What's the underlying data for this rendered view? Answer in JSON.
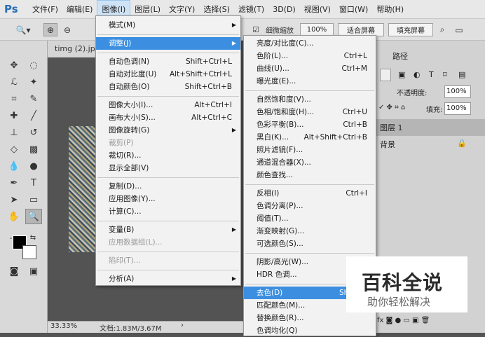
{
  "app": {
    "logo": "Ps"
  },
  "menubar": {
    "items": [
      "文件(F)",
      "编辑(E)",
      "图像(I)",
      "图层(L)",
      "文字(Y)",
      "选择(S)",
      "滤镜(T)",
      "3D(D)",
      "视图(V)",
      "窗口(W)",
      "帮助(H)"
    ],
    "active_index": 2
  },
  "options": {
    "fine_zoom_label": "细微缩放",
    "zoom_percent": "100%",
    "fit_screen": "适合屏幕",
    "fill_screen": "填充屏幕"
  },
  "document": {
    "tab_name": "timg (2).jpg",
    "zoom": "33.33%",
    "doc_size": "文档:1.83M/3.67M"
  },
  "right_panel": {
    "tab_paths": "路径",
    "opacity_label": "不透明度:",
    "opacity_value": "100%",
    "fill_label": "填充:",
    "fill_value": "100%",
    "layer1": "图层 1",
    "background": "背景"
  },
  "image_menu": {
    "items": [
      {
        "label": "模式(M)",
        "shortcut": "",
        "submenu": true
      },
      {
        "label": "调整(J)",
        "shortcut": "",
        "submenu": true,
        "highlight": true
      },
      {
        "label": "自动色调(N)",
        "shortcut": "Shift+Ctrl+L"
      },
      {
        "label": "自动对比度(U)",
        "shortcut": "Alt+Shift+Ctrl+L"
      },
      {
        "label": "自动颜色(O)",
        "shortcut": "Shift+Ctrl+B"
      },
      {
        "label": "图像大小(I)...",
        "shortcut": "Alt+Ctrl+I"
      },
      {
        "label": "画布大小(S)...",
        "shortcut": "Alt+Ctrl+C"
      },
      {
        "label": "图像旋转(G)",
        "shortcut": "",
        "submenu": true
      },
      {
        "label": "裁剪(P)",
        "shortcut": "",
        "disabled": true
      },
      {
        "label": "裁切(R)...",
        "shortcut": ""
      },
      {
        "label": "显示全部(V)",
        "shortcut": ""
      },
      {
        "label": "复制(D)...",
        "shortcut": ""
      },
      {
        "label": "应用图像(Y)...",
        "shortcut": ""
      },
      {
        "label": "计算(C)...",
        "shortcut": ""
      },
      {
        "label": "变量(B)",
        "shortcut": "",
        "submenu": true
      },
      {
        "label": "应用数据组(L)...",
        "shortcut": "",
        "disabled": true
      },
      {
        "label": "陷印(T)...",
        "shortcut": "",
        "disabled": true
      },
      {
        "label": "分析(A)",
        "shortcut": "",
        "submenu": true
      }
    ]
  },
  "adjust_menu": {
    "items": [
      {
        "label": "亮度/对比度(C)...",
        "shortcut": ""
      },
      {
        "label": "色阶(L)...",
        "shortcut": "Ctrl+L"
      },
      {
        "label": "曲线(U)...",
        "shortcut": "Ctrl+M"
      },
      {
        "label": "曝光度(E)...",
        "shortcut": ""
      },
      {
        "label": "自然饱和度(V)...",
        "shortcut": ""
      },
      {
        "label": "色相/饱和度(H)...",
        "shortcut": "Ctrl+U"
      },
      {
        "label": "色彩平衡(B)...",
        "shortcut": "Ctrl+B"
      },
      {
        "label": "黑白(K)...",
        "shortcut": "Alt+Shift+Ctrl+B"
      },
      {
        "label": "照片滤镜(F)...",
        "shortcut": ""
      },
      {
        "label": "通道混合器(X)...",
        "shortcut": ""
      },
      {
        "label": "颜色查找...",
        "shortcut": ""
      },
      {
        "label": "反相(I)",
        "shortcut": "Ctrl+I"
      },
      {
        "label": "色调分离(P)...",
        "shortcut": ""
      },
      {
        "label": "阈值(T)...",
        "shortcut": ""
      },
      {
        "label": "渐变映射(G)...",
        "shortcut": ""
      },
      {
        "label": "可选颜色(S)...",
        "shortcut": ""
      },
      {
        "label": "阴影/高光(W)...",
        "shortcut": ""
      },
      {
        "label": "HDR 色调...",
        "shortcut": ""
      },
      {
        "label": "去色(D)",
        "shortcut": "Shift+C",
        "highlight": true
      },
      {
        "label": "匹配颜色(M)...",
        "shortcut": ""
      },
      {
        "label": "替换颜色(R)...",
        "shortcut": ""
      },
      {
        "label": "色调均化(Q)",
        "shortcut": ""
      }
    ]
  },
  "watermark": {
    "title": "百科全说",
    "subtitle": "助你轻松解决"
  },
  "colors": {
    "highlight": "#3c8fe0",
    "menu_bg": "#f2f2f2"
  }
}
